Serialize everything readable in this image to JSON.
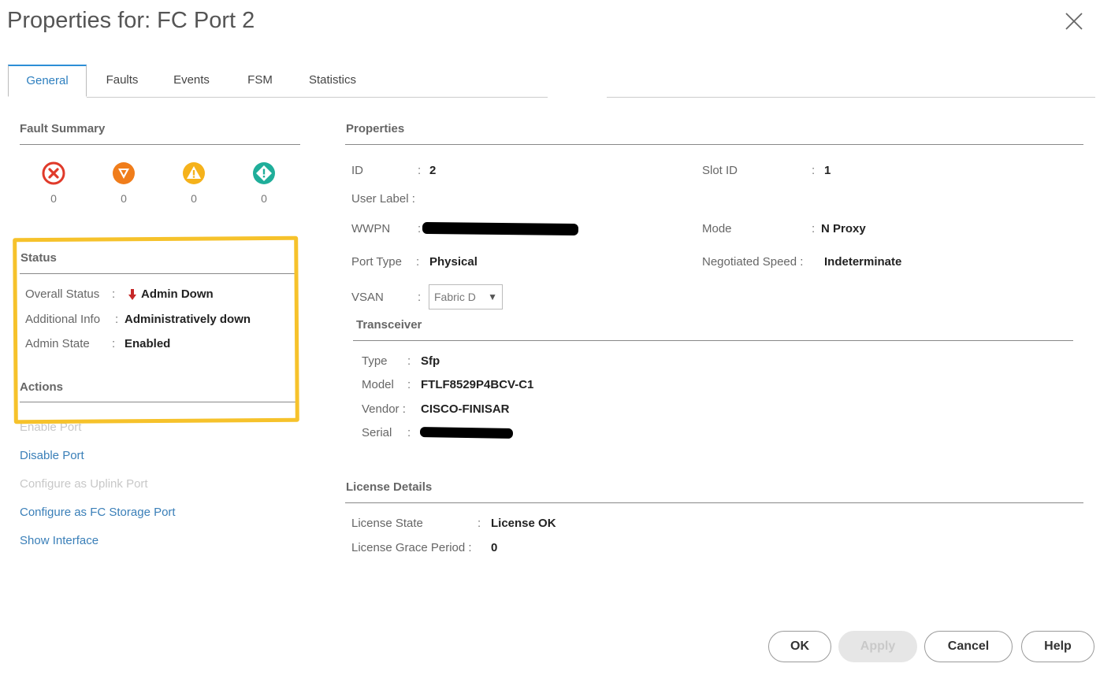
{
  "dialog": {
    "title": "Properties for: FC Port 2"
  },
  "tabs": [
    {
      "label": "General",
      "active": true
    },
    {
      "label": "Faults"
    },
    {
      "label": "Events"
    },
    {
      "label": "FSM"
    },
    {
      "label": "Statistics"
    }
  ],
  "fault_summary": {
    "title": "Fault Summary",
    "items": [
      {
        "icon": "critical-icon",
        "count": "0",
        "color": "#e03a2a"
      },
      {
        "icon": "major-icon",
        "count": "0",
        "color": "#f07d1b"
      },
      {
        "icon": "minor-icon",
        "count": "0",
        "color": "#f5b21b"
      },
      {
        "icon": "warning-icon",
        "count": "0",
        "color": "#1fae9a"
      }
    ]
  },
  "status": {
    "title": "Status",
    "overall_label": "Overall Status",
    "overall_value": "Admin Down",
    "additional_label": "Additional Info",
    "additional_value": "Administratively down",
    "admin_label": "Admin State",
    "admin_value": "Enabled",
    "sep": ":"
  },
  "actions": {
    "title": "Actions",
    "items": [
      {
        "label": "Enable Port",
        "enabled": false
      },
      {
        "label": "Disable Port",
        "enabled": true
      },
      {
        "label": "Configure as Uplink Port",
        "enabled": false
      },
      {
        "label": "Configure as FC Storage Port",
        "enabled": true
      },
      {
        "label": "Show Interface",
        "enabled": true
      }
    ]
  },
  "properties": {
    "title": "Properties",
    "id_label": "ID",
    "id_value": "2",
    "slot_label": "Slot ID",
    "slot_value": "1",
    "user_label_label": "User Label :",
    "wwpn_label": "WWPN",
    "mode_label": "Mode",
    "mode_value": "N Proxy",
    "port_type_label": "Port Type",
    "port_type_value": "Physical",
    "speed_label": "Negotiated Speed :",
    "speed_value": "Indeterminate",
    "vsan_label": "VSAN",
    "vsan_value": "Fabric D"
  },
  "transceiver": {
    "title": "Transceiver",
    "type_label": "Type",
    "type_value": "Sfp",
    "model_label": "Model",
    "model_value": "FTLF8529P4BCV-C1",
    "vendor_label": "Vendor :",
    "vendor_value": "CISCO-FINISAR",
    "serial_label": "Serial"
  },
  "license": {
    "title": "License Details",
    "state_label": "License State",
    "state_value": "License OK",
    "grace_label": "License Grace Period :",
    "grace_value": "0"
  },
  "buttons": {
    "ok": "OK",
    "apply": "Apply",
    "cancel": "Cancel",
    "help": "Help"
  },
  "colors": {
    "accent": "#2d8ed6",
    "link": "#3a7fb8",
    "highlight": "#f6c22b",
    "down_arrow": "#c62828"
  }
}
